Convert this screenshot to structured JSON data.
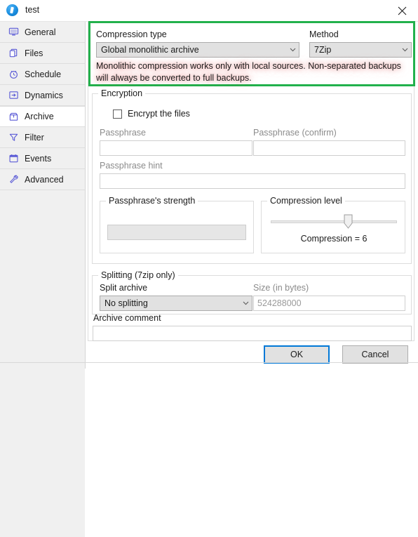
{
  "window": {
    "title": "test",
    "icon": "app-circle-icon",
    "close_label": "✕"
  },
  "sidebar": {
    "items": [
      {
        "label": "General",
        "icon": "monitor-icon",
        "selected": false
      },
      {
        "label": "Files",
        "icon": "files-icon",
        "selected": false
      },
      {
        "label": "Schedule",
        "icon": "clock-icon",
        "selected": false
      },
      {
        "label": "Dynamics",
        "icon": "arrow-box-icon",
        "selected": false
      },
      {
        "label": "Archive",
        "icon": "archive-icon",
        "selected": true
      },
      {
        "label": "Filter",
        "icon": "funnel-icon",
        "selected": false
      },
      {
        "label": "Events",
        "icon": "calendar-icon",
        "selected": false
      },
      {
        "label": "Advanced",
        "icon": "wrench-icon",
        "selected": false
      }
    ]
  },
  "highlight": {
    "border_color": "#22b14c",
    "compression_type_label": "Compression type",
    "compression_type_value": "Global monolithic archive",
    "method_label": "Method",
    "method_value": "7Zip",
    "warning_text": "Monolithic compression works only with local sources. Non-separated backups will always be converted to full backups."
  },
  "encryption": {
    "group_title": "Encryption",
    "encrypt_checkbox_label": "Encrypt the files",
    "encrypt_checked": false,
    "passphrase_label": "Passphrase",
    "passphrase_value": "",
    "passphrase_confirm_label": "Passphrase (confirm)",
    "passphrase_confirm_value": "",
    "passphrase_hint_label": "Passphrase hint",
    "passphrase_hint_value": "",
    "strength_group_title": "Passphrase's strength",
    "strength_value": "",
    "compression_level_title": "Compression level",
    "compression_level_text": "Compression = 6",
    "compression_level_percent": 62
  },
  "splitting": {
    "group_title": "Splitting (7zip only)",
    "split_archive_label": "Split archive",
    "split_archive_value": "No splitting",
    "size_label": "Size (in bytes)",
    "size_value": "524288000"
  },
  "archive_comment": {
    "label": "Archive comment",
    "value": ""
  },
  "footer": {
    "ok_label": "OK",
    "cancel_label": "Cancel"
  },
  "colors": {
    "accent": "#0078d7",
    "highlight_green": "#22b14c",
    "icon_purple": "#5b5bd6",
    "dialog_bg": "#ffffff",
    "sidebar_bg": "#f0f0f0"
  }
}
